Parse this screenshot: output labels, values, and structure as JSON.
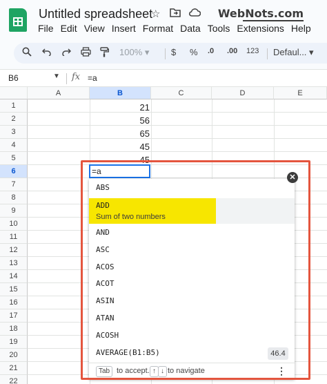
{
  "app": {
    "doc_title": "Untitled spreadsheet",
    "watermark": "WebNots.com"
  },
  "menu": [
    "File",
    "Edit",
    "View",
    "Insert",
    "Format",
    "Data",
    "Tools",
    "Extensions",
    "Help"
  ],
  "toolbar": {
    "zoom": "100%",
    "currency": "$",
    "percent": "%",
    "decrease_decimals": ".0",
    "increase_decimals": ".00",
    "more_formats": "123",
    "font": "Defaul..."
  },
  "formula_bar": {
    "cell_ref": "B6",
    "fx_label": "fx",
    "formula": "=a"
  },
  "columns": [
    "A",
    "B",
    "C",
    "D",
    "E"
  ],
  "rows": [
    "1",
    "2",
    "3",
    "4",
    "5",
    "6",
    "7",
    "8",
    "9",
    "10",
    "11",
    "12",
    "13",
    "14",
    "15",
    "16",
    "17",
    "18",
    "19",
    "20",
    "21",
    "22"
  ],
  "column_b_values": [
    "21",
    "56",
    "65",
    "45",
    "45"
  ],
  "active_cell_input": "=a",
  "autocomplete": {
    "items": [
      "ABS",
      "AND",
      "ASC",
      "ACOS",
      "ACOT",
      "ASIN",
      "ATAN",
      "ACOSH",
      "AVERAGE(B1:B5)"
    ],
    "highlighted": {
      "name": "ADD",
      "description": "Sum of two numbers"
    },
    "average_preview": "46.4",
    "footer": {
      "tab_key": "Tab",
      "accept_text": "to accept.",
      "up_key": "↑",
      "down_key": "↓",
      "navigate_text": "to navigate"
    }
  },
  "colors": {
    "highlight": "#f7e600",
    "annotation": "#e4553e",
    "selection": "#1a73e8"
  }
}
